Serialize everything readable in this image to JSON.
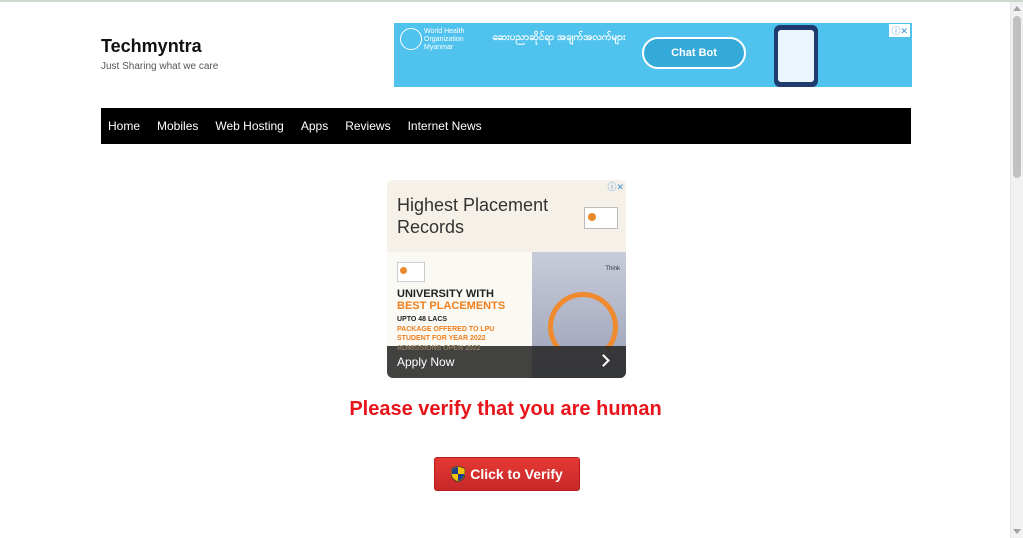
{
  "header": {
    "site_title": "Techmyntra",
    "tagline": "Just Sharing what we care"
  },
  "banner_ad": {
    "org_name_line1": "World Health",
    "org_name_line2": "Organization",
    "org_region": "Myanmar",
    "headline": "ဆေးပညာဆိုင်ရာ အချက်အလက်များ",
    "bubble_text": "Chat Bot",
    "icons": "ⓘ✕"
  },
  "nav": {
    "items": [
      "Home",
      "Mobiles",
      "Web Hosting",
      "Apps",
      "Reviews",
      "Internet News"
    ]
  },
  "mid_ad": {
    "headline": "Highest Placement Records",
    "icons": "ⓘ✕",
    "line1": "UNIVERSITY WITH",
    "line2": "BEST PLACEMENTS",
    "line3": "UPTO 48 LACS",
    "line4": "PACKAGE OFFERED TO LPU STUDENT FOR YEAR 2022",
    "ghost_text": "ADMISSIONS OPEN 2022",
    "photo_brand": "Think",
    "cta_label": "Apply Now"
  },
  "verify": {
    "heading": "Please verify that you are human",
    "button_label": "Click to Verify"
  }
}
